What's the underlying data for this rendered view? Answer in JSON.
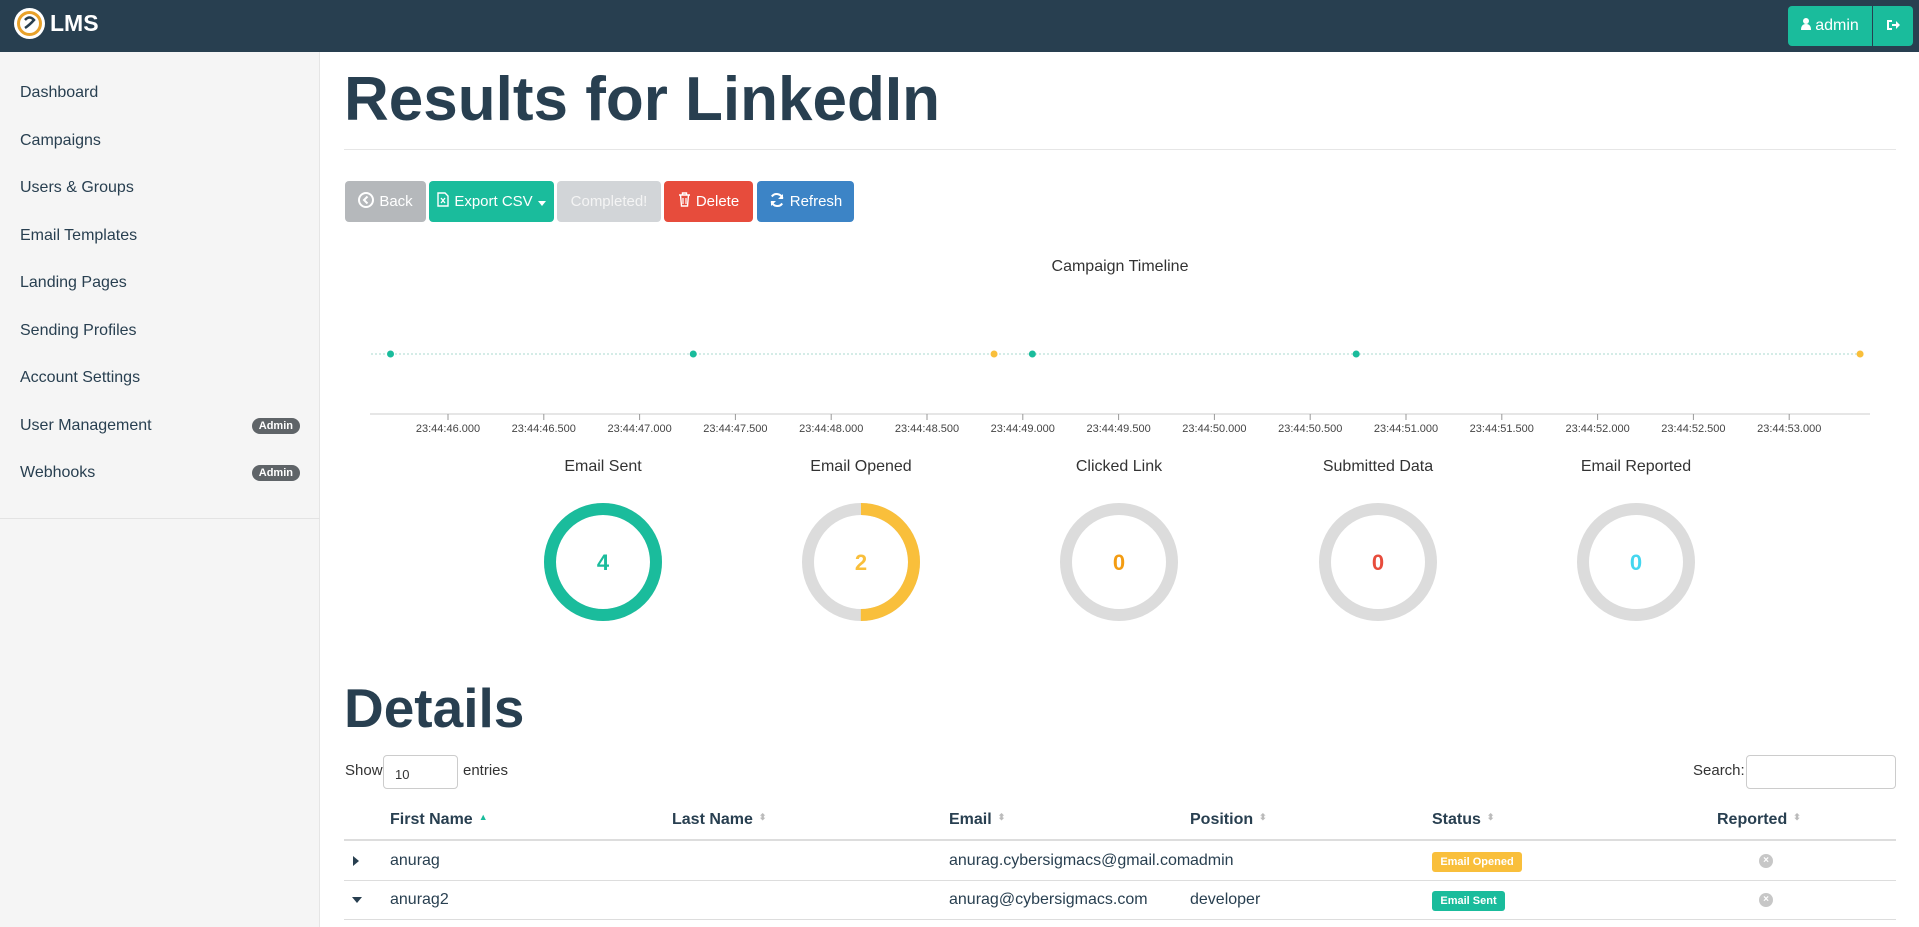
{
  "header": {
    "brand": "LMS",
    "user_label": "admin"
  },
  "sidebar": {
    "items": [
      {
        "label": "Dashboard"
      },
      {
        "label": "Campaigns"
      },
      {
        "label": "Users & Groups"
      },
      {
        "label": "Email Templates"
      },
      {
        "label": "Landing Pages"
      },
      {
        "label": "Sending Profiles"
      },
      {
        "label": "Account Settings"
      },
      {
        "label": "User Management",
        "badge": "Admin"
      },
      {
        "label": "Webhooks",
        "badge": "Admin"
      }
    ]
  },
  "page": {
    "title": "Results for LinkedIn"
  },
  "toolbar": {
    "back": "Back",
    "export": "Export CSV",
    "completed": "Completed!",
    "delete": "Delete",
    "refresh": "Refresh"
  },
  "timeline": {
    "title": "Campaign Timeline",
    "tick_labels": [
      "23:44:46.000",
      "23:44:46.500",
      "23:44:47.000",
      "23:44:47.500",
      "23:44:48.000",
      "23:44:48.500",
      "23:44:49.000",
      "23:44:49.500",
      "23:44:50.000",
      "23:44:50.500",
      "23:44:51.000",
      "23:44:51.500",
      "23:44:52.000",
      "23:44:52.500",
      "23:44:53.000"
    ],
    "events": [
      {
        "time": "23:44:45.700",
        "type": "Email Sent",
        "color": "#1abc9c"
      },
      {
        "time": "23:44:47.280",
        "type": "Email Sent",
        "color": "#1abc9c"
      },
      {
        "time": "23:44:48.850",
        "type": "Email Opened",
        "color": "#f9bf3b"
      },
      {
        "time": "23:44:49.050",
        "type": "Email Sent",
        "color": "#1abc9c"
      },
      {
        "time": "23:44:50.740",
        "type": "Email Sent",
        "color": "#1abc9c"
      },
      {
        "time": "23:44:53.370",
        "type": "Email Opened",
        "color": "#f9bf3b"
      }
    ]
  },
  "stats": [
    {
      "label": "Email Sent",
      "value": "4",
      "fraction": 1.0,
      "color": "#1abc9c"
    },
    {
      "label": "Email Opened",
      "value": "2",
      "fraction": 0.5,
      "color": "#f9bf3b"
    },
    {
      "label": "Clicked Link",
      "value": "0",
      "fraction": 0,
      "color": "#f39c12"
    },
    {
      "label": "Submitted Data",
      "value": "0",
      "fraction": 0,
      "color": "#e74c3c"
    },
    {
      "label": "Email Reported",
      "value": "0",
      "fraction": 0,
      "color": "#45d6ef"
    }
  ],
  "details": {
    "heading": "Details",
    "show_label": "Show",
    "page_size": "10",
    "entries_label": "entries",
    "search_label": "Search:",
    "columns": [
      "First Name",
      "Last Name",
      "Email",
      "Position",
      "Status",
      "Reported"
    ],
    "rows": [
      {
        "first": "anurag",
        "last": "",
        "email": "anurag.cybersigmacs@gmail.com",
        "position": "admin",
        "status": "Email Opened",
        "status_color": "#f9bf3b"
      },
      {
        "first": "anurag2",
        "last": "",
        "email": "anurag@cybersigmacs.com",
        "position": "developer",
        "status": "Email Sent",
        "status_color": "#1abc9c"
      }
    ]
  }
}
